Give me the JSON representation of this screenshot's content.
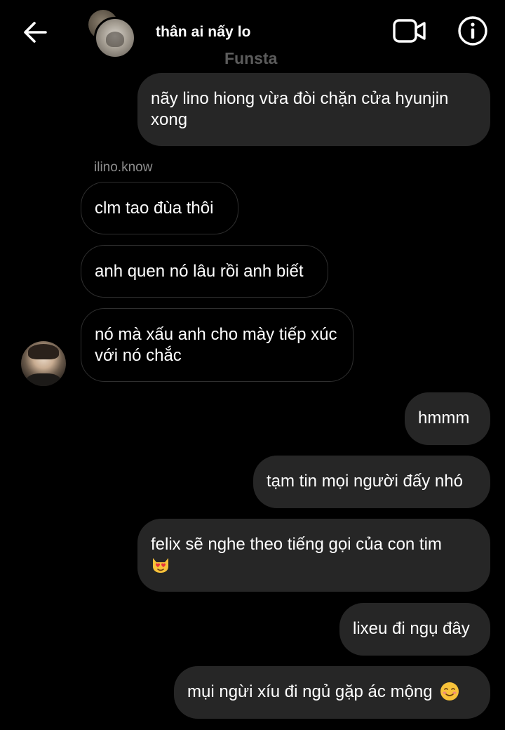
{
  "header": {
    "title": "thân ai nấy lo",
    "subtitle": "Funsta",
    "back_icon": "arrow-left-icon",
    "video_icon": "video-camera-icon",
    "info_icon": "info-icon"
  },
  "messages": [
    {
      "direction": "out",
      "text": "nãy lino hiong vừa đòi chặn cửa hyunjin xong"
    },
    {
      "direction": "in",
      "sender": "ilino.know",
      "text": "clm tao đùa thôi"
    },
    {
      "direction": "in",
      "text": "anh quen nó lâu rồi anh biết"
    },
    {
      "direction": "in",
      "text": "nó mà xấu anh cho mày tiếp xúc với nó chắc"
    },
    {
      "direction": "out",
      "text": "hmmm"
    },
    {
      "direction": "out",
      "text": "tạm tin mọi người đấy nhó"
    },
    {
      "direction": "out",
      "text": "felix sẽ nghe theo tiếng gọi của con tim",
      "emoji": "heart-eyes-cat"
    },
    {
      "direction": "out",
      "text": "lixeu đi ngụ đây"
    },
    {
      "direction": "out",
      "text": "mụi ngừi xíu đi ngủ gặp ác mộng",
      "emoji": "smiling-face-icon"
    }
  ],
  "colors": {
    "background": "#000000",
    "outgoing_bubble": "#262626",
    "incoming_border": "#2f2f2f",
    "sender_name": "#8e8e8e",
    "subtitle": "#5c5c5c"
  }
}
